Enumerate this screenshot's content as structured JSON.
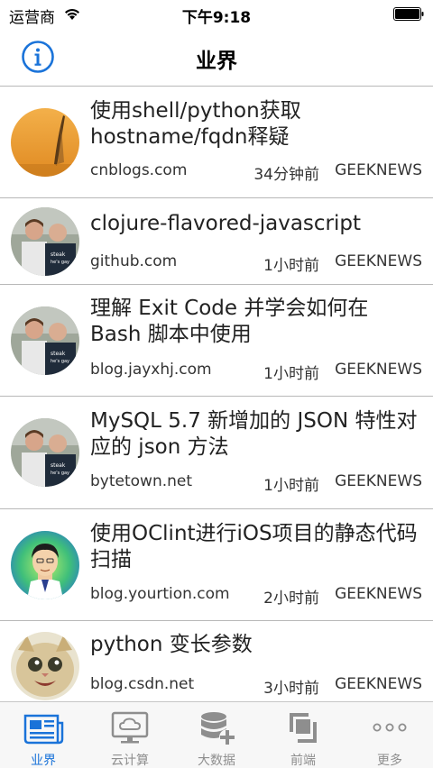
{
  "status_bar": {
    "carrier": "运营商",
    "time": "下午9:18"
  },
  "nav": {
    "title": "业界",
    "left_icon": "info-icon"
  },
  "articles": [
    {
      "title": "使用shell/python获取hostname/fqdn释疑",
      "source": "cnblogs.com",
      "time": "34分钟前",
      "channel": "GEEKNEWS",
      "avatar": "feather-photo"
    },
    {
      "title": "clojure-flavored-javascript",
      "source": "github.com",
      "time": "1小时前",
      "channel": "GEEKNEWS",
      "avatar": "two-people-photo"
    },
    {
      "title": "理解 Exit Code 并学会如何在 Bash 脚本中使用",
      "source": "blog.jayxhj.com",
      "time": "1小时前",
      "channel": "GEEKNEWS",
      "avatar": "two-people-photo"
    },
    {
      "title": "MySQL 5.7 新增加的 JSON 特性对应的 json 方法",
      "source": "bytetown.net",
      "time": "1小时前",
      "channel": "GEEKNEWS",
      "avatar": "two-people-photo"
    },
    {
      "title": "使用OClint进行iOS项目的静态代码扫描",
      "source": "blog.yourtion.com",
      "time": "2小时前",
      "channel": "GEEKNEWS",
      "avatar": "cartoon-man"
    },
    {
      "title": "python 变长参数",
      "source": "blog.csdn.net",
      "time": "3小时前",
      "channel": "GEEKNEWS",
      "avatar": "cat-photo"
    }
  ],
  "tabs": [
    {
      "label": "业界",
      "icon": "newspaper-icon",
      "active": true
    },
    {
      "label": "云计算",
      "icon": "cloud-monitor-icon",
      "active": false
    },
    {
      "label": "大数据",
      "icon": "database-plus-icon",
      "active": false
    },
    {
      "label": "前端",
      "icon": "layers-icon",
      "active": false
    },
    {
      "label": "更多",
      "icon": "more-dots-icon",
      "active": false
    }
  ],
  "colors": {
    "accent": "#1a73d9",
    "tab_inactive": "#8e8e8e",
    "separator": "#b8b8b8"
  }
}
